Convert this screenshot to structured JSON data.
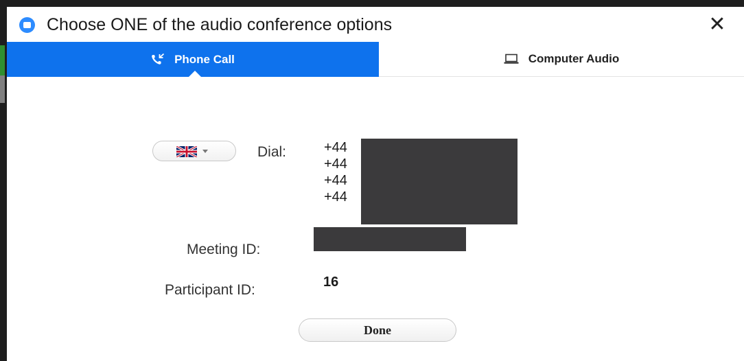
{
  "window": {
    "title": "Choose ONE of the audio conference options",
    "close_glyph": "✕",
    "app_icon": "zoom-camera-icon"
  },
  "tabs": [
    {
      "label": "Phone Call",
      "icon": "phone-call-icon",
      "selected": true
    },
    {
      "label": "Computer Audio",
      "icon": "laptop-icon",
      "selected": false
    }
  ],
  "colors": {
    "accent": "#0e72ed",
    "redaction": "#3b3a3c"
  },
  "country_select": {
    "icon": "uk-flag-icon"
  },
  "dial": {
    "label": "Dial:",
    "numbers": [
      "+44",
      "+44",
      "+44",
      "+44"
    ]
  },
  "meeting": {
    "label": "Meeting ID:"
  },
  "participant": {
    "label": "Participant ID:",
    "value": "16"
  },
  "done_button": {
    "label": "Done"
  }
}
